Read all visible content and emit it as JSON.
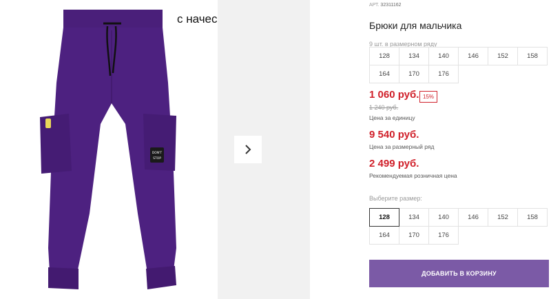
{
  "gallery": {
    "caption": "с начесом",
    "next_icon": "chevron-right-icon",
    "product_color": "#4a1f7a",
    "patch_text_line1": "DON'T",
    "patch_text_line2": "STOP"
  },
  "product": {
    "sku_label": "АРТ.",
    "sku_value": "32311162",
    "title": "Брюки для мальчика",
    "size_range_label": "9 шт. в размерном ряду",
    "size_range": [
      "128",
      "134",
      "140",
      "146",
      "152",
      "158",
      "164",
      "170",
      "176"
    ],
    "price": "1 060 руб.",
    "discount_badge": "15%",
    "old_price": "1 240 руб.",
    "unit_price_note": "Цена за единицу",
    "range_price": "9 540 руб.",
    "range_price_note": "Цена за размерный ряд",
    "retail_price": "2 499 руб.",
    "retail_price_note": "Рекомендуемая розничная цена",
    "choose_size_label": "Выберите размер:",
    "sizes": [
      "128",
      "134",
      "140",
      "146",
      "152",
      "158",
      "164",
      "170",
      "176"
    ],
    "selected_size": "128",
    "add_to_cart_label": "ДОБАВИТЬ В КОРЗИНУ"
  },
  "colors": {
    "price_red": "#d0202a",
    "button_purple": "#7b5aa6"
  }
}
